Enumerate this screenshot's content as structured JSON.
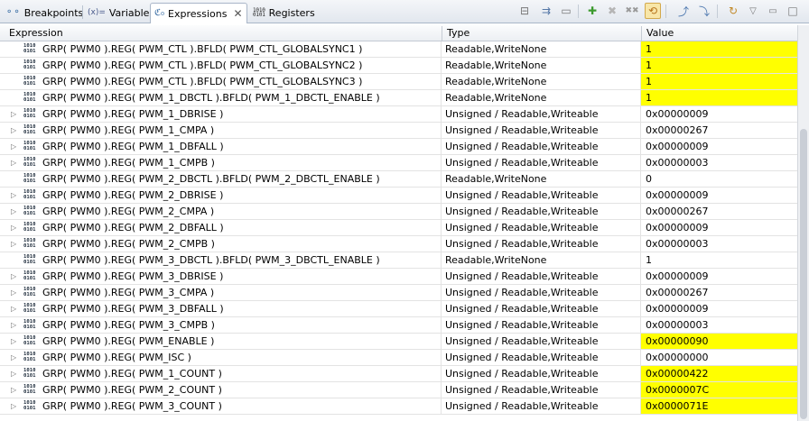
{
  "tabs": [
    {
      "label": "Breakpoints",
      "icon": "breakpoints-icon",
      "glyph": "⚬⚬"
    },
    {
      "label": "Variables",
      "icon": "variables-icon",
      "glyph": "(x)="
    },
    {
      "label": "Expressions",
      "icon": "expressions-icon",
      "glyph": "ℭ₀",
      "active": true
    },
    {
      "label": "Registers",
      "icon": "registers-icon",
      "glyph": "binary"
    }
  ],
  "tab_close_glyph": "✕",
  "toolbar": {
    "buttons": [
      {
        "name": "collapse-all-icon",
        "glyph": "⊟"
      },
      {
        "name": "expand-icon",
        "glyph": "⇉"
      },
      {
        "name": "minimize-icon",
        "glyph": "▭"
      },
      {
        "name": "add-expression-icon",
        "glyph": "✚",
        "color": "#3c9a2e"
      },
      {
        "name": "remove-expression-icon",
        "glyph": "✖"
      },
      {
        "name": "remove-all-icon",
        "glyph": "✖✖"
      },
      {
        "name": "continuous-refresh-icon",
        "glyph": "⟲",
        "selected": true
      },
      {
        "name": "export-icon",
        "glyph": "⤴"
      },
      {
        "name": "import-icon",
        "glyph": "⤵"
      },
      {
        "name": "refresh-icon",
        "glyph": "↻"
      },
      {
        "name": "view-menu-icon",
        "glyph": "▽"
      },
      {
        "name": "minimize-view-icon",
        "glyph": "▭"
      },
      {
        "name": "maximize-view-icon",
        "glyph": "□"
      }
    ]
  },
  "columns": {
    "expression": "Expression",
    "type": "Type",
    "value": "Value"
  },
  "highlight_color": "#ffff00",
  "binary_glyph": "1010\n0101",
  "expander_glyph": "▷",
  "rows": [
    {
      "expr": "GRP( PWM0 ).REG( PWM_CTL ).BFLD( PWM_CTL_GLOBALSYNC1 )",
      "type": "Readable,WriteNone",
      "value": "1",
      "expandable": false,
      "highlight": true
    },
    {
      "expr": "GRP( PWM0 ).REG( PWM_CTL ).BFLD( PWM_CTL_GLOBALSYNC2 )",
      "type": "Readable,WriteNone",
      "value": "1",
      "expandable": false,
      "highlight": true
    },
    {
      "expr": "GRP( PWM0 ).REG( PWM_CTL ).BFLD( PWM_CTL_GLOBALSYNC3 )",
      "type": "Readable,WriteNone",
      "value": "1",
      "expandable": false,
      "highlight": true
    },
    {
      "expr": "GRP( PWM0 ).REG( PWM_1_DBCTL ).BFLD( PWM_1_DBCTL_ENABLE )",
      "type": "Readable,WriteNone",
      "value": "1",
      "expandable": false,
      "highlight": true
    },
    {
      "expr": "GRP( PWM0 ).REG( PWM_1_DBRISE )",
      "type": "Unsigned / Readable,Writeable",
      "value": "0x00000009",
      "expandable": true,
      "highlight": false
    },
    {
      "expr": "GRP( PWM0 ).REG( PWM_1_CMPA )",
      "type": "Unsigned / Readable,Writeable",
      "value": "0x00000267",
      "expandable": true,
      "highlight": false
    },
    {
      "expr": "GRP( PWM0 ).REG( PWM_1_DBFALL )",
      "type": "Unsigned / Readable,Writeable",
      "value": "0x00000009",
      "expandable": true,
      "highlight": false
    },
    {
      "expr": "GRP( PWM0 ).REG( PWM_1_CMPB )",
      "type": "Unsigned / Readable,Writeable",
      "value": "0x00000003",
      "expandable": true,
      "highlight": false
    },
    {
      "expr": "GRP( PWM0 ).REG( PWM_2_DBCTL ).BFLD( PWM_2_DBCTL_ENABLE )",
      "type": "Readable,WriteNone",
      "value": "0",
      "expandable": false,
      "highlight": false
    },
    {
      "expr": "GRP( PWM0 ).REG( PWM_2_DBRISE )",
      "type": "Unsigned / Readable,Writeable",
      "value": "0x00000009",
      "expandable": true,
      "highlight": false
    },
    {
      "expr": "GRP( PWM0 ).REG( PWM_2_CMPA )",
      "type": "Unsigned / Readable,Writeable",
      "value": "0x00000267",
      "expandable": true,
      "highlight": false
    },
    {
      "expr": "GRP( PWM0 ).REG( PWM_2_DBFALL )",
      "type": "Unsigned / Readable,Writeable",
      "value": "0x00000009",
      "expandable": true,
      "highlight": false
    },
    {
      "expr": "GRP( PWM0 ).REG( PWM_2_CMPB )",
      "type": "Unsigned / Readable,Writeable",
      "value": "0x00000003",
      "expandable": true,
      "highlight": false
    },
    {
      "expr": "GRP( PWM0 ).REG( PWM_3_DBCTL ).BFLD( PWM_3_DBCTL_ENABLE )",
      "type": "Readable,WriteNone",
      "value": "1",
      "expandable": false,
      "highlight": false
    },
    {
      "expr": "GRP( PWM0 ).REG( PWM_3_DBRISE )",
      "type": "Unsigned / Readable,Writeable",
      "value": "0x00000009",
      "expandable": true,
      "highlight": false
    },
    {
      "expr": "GRP( PWM0 ).REG( PWM_3_CMPA )",
      "type": "Unsigned / Readable,Writeable",
      "value": "0x00000267",
      "expandable": true,
      "highlight": false
    },
    {
      "expr": "GRP( PWM0 ).REG( PWM_3_DBFALL )",
      "type": "Unsigned / Readable,Writeable",
      "value": "0x00000009",
      "expandable": true,
      "highlight": false
    },
    {
      "expr": "GRP( PWM0 ).REG( PWM_3_CMPB )",
      "type": "Unsigned / Readable,Writeable",
      "value": "0x00000003",
      "expandable": true,
      "highlight": false
    },
    {
      "expr": "GRP( PWM0 ).REG( PWM_ENABLE )",
      "type": "Unsigned / Readable,Writeable",
      "value": "0x00000090",
      "expandable": true,
      "highlight": true
    },
    {
      "expr": "GRP( PWM0 ).REG( PWM_ISC )",
      "type": "Unsigned / Readable,Writeable",
      "value": "0x00000000",
      "expandable": true,
      "highlight": false
    },
    {
      "expr": "GRP( PWM0 ).REG( PWM_1_COUNT )",
      "type": "Unsigned / Readable,Writeable",
      "value": "0x00000422",
      "expandable": true,
      "highlight": true
    },
    {
      "expr": "GRP( PWM0 ).REG( PWM_2_COUNT )",
      "type": "Unsigned / Readable,Writeable",
      "value": "0x0000007C",
      "expandable": true,
      "highlight": true
    },
    {
      "expr": "GRP( PWM0 ).REG( PWM_3_COUNT )",
      "type": "Unsigned / Readable,Writeable",
      "value": "0x0000071E",
      "expandable": true,
      "highlight": true
    }
  ]
}
